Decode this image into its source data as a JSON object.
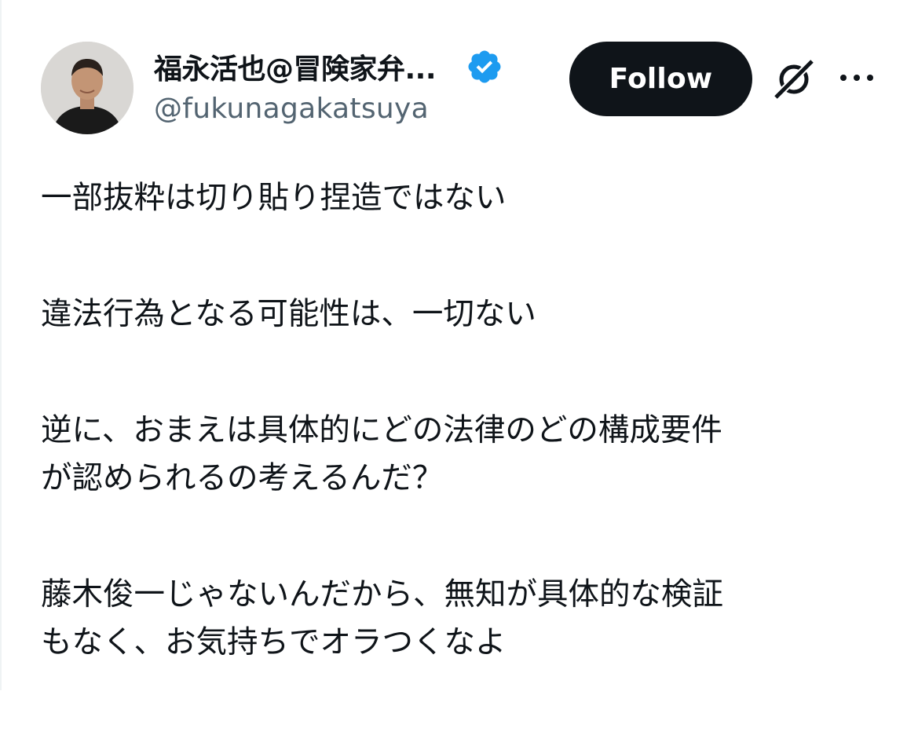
{
  "author": {
    "display_name": "福永活也@冒険家弁...",
    "handle": "@fukunagakatsuya",
    "verified": true,
    "verified_color": "#1d9bf0"
  },
  "actions": {
    "follow_label": "Follow",
    "grok_icon": "grok-icon",
    "more_icon": "more-icon"
  },
  "tweet": {
    "paragraphs": [
      {
        "lines": [
          "一部抜粋は切り貼り捏造ではない"
        ]
      },
      {
        "lines": [
          "違法行為となる可能性は、一切ない"
        ]
      },
      {
        "lines": [
          "逆に、おまえは具体的にどの法律のどの構成要件",
          "が認められるの考えるんだ？"
        ]
      },
      {
        "lines": [
          "藤木俊一じゃないんだから、無知が具体的な検証",
          "もなく、お気持ちでオラつくなよ"
        ]
      }
    ]
  }
}
